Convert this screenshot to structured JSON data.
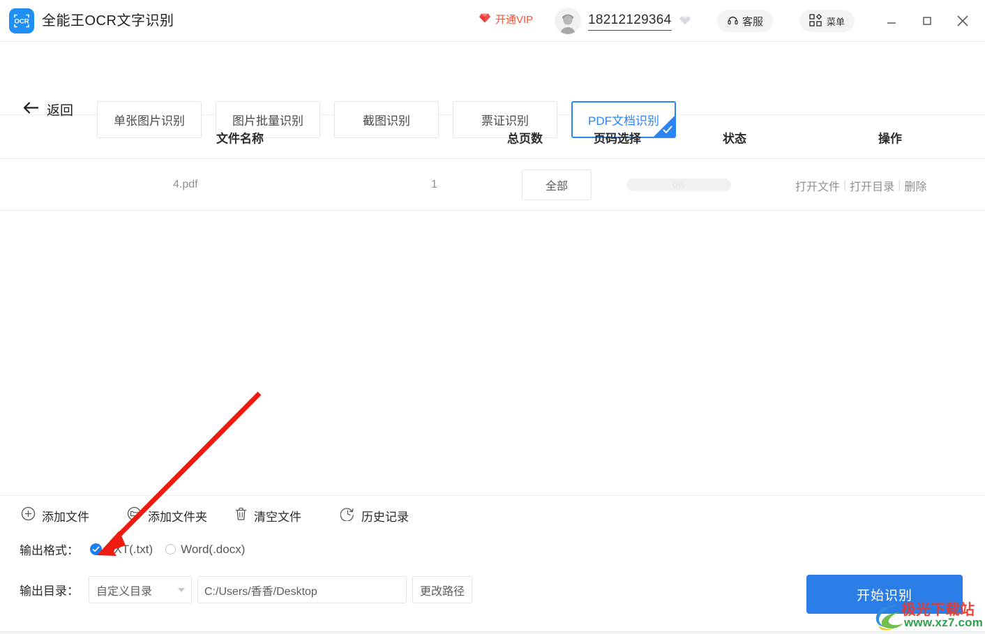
{
  "window": {
    "logo_text": "OCR",
    "app_title": "全能王OCR文字识别",
    "vip_label": "开通VIP",
    "account_phone": "18212129364",
    "support_label": "客服",
    "menu_label": "菜单",
    "minimize_label": "最小化",
    "maximize_label": "最大化",
    "close_label": "关闭"
  },
  "nav": {
    "back_label": "返回",
    "tabs": [
      {
        "label": "单张图片识别",
        "selected": false
      },
      {
        "label": "图片批量识别",
        "selected": false
      },
      {
        "label": "截图识别",
        "selected": false
      },
      {
        "label": "票证识别",
        "selected": false
      },
      {
        "label": "PDF文档识别",
        "selected": true
      }
    ]
  },
  "table": {
    "columns": [
      "文件名称",
      "总页数",
      "页码选择",
      "状态",
      "操作"
    ],
    "rows": [
      {
        "filename": "4.pdf",
        "total_pages": "1",
        "page_select": "全部",
        "status_percent": "0%",
        "actions": [
          "打开文件",
          "打开目录",
          "删除"
        ]
      }
    ]
  },
  "toolbar": {
    "add_file": "添加文件",
    "add_folder": "添加文件夹",
    "clear_files": "清空文件",
    "history": "历史记录"
  },
  "output": {
    "format_label": "输出格式：",
    "format_options": [
      {
        "label": "TXT(.txt)",
        "selected": true
      },
      {
        "label": "Word(.docx)",
        "selected": false
      }
    ],
    "dir_label": "输出目录：",
    "dir_mode": "自定义目录",
    "dir_path": "C:/Users/香香/Desktop",
    "change_path_label": "更改路径",
    "start_label": "开始识别"
  },
  "watermark": {
    "site_name": "极光下载站",
    "site_url": "www.xz7.com"
  },
  "colors": {
    "accent": "#2b85f5",
    "primary_button": "#2b7ee8",
    "vip_red": "#f4553c",
    "logo_blue": "#1f8ff5",
    "annotation_red": "#ee1b11",
    "watermark_red": "#e8392a",
    "watermark_green": "#2aa34a"
  }
}
